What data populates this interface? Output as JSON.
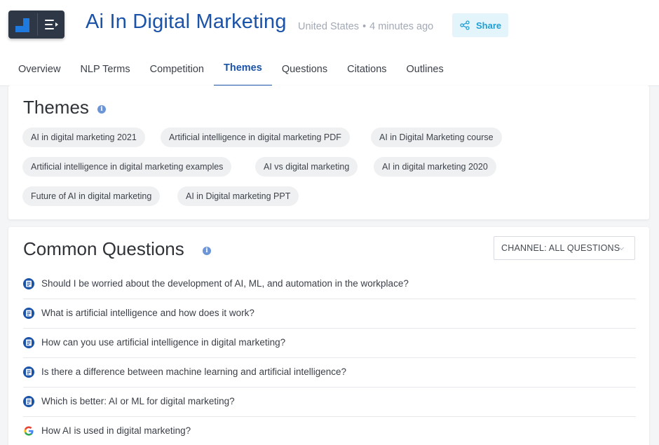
{
  "header": {
    "title": "Ai In Digital Marketing",
    "country": "United States",
    "updated": "4 minutes ago",
    "share_label": "Share"
  },
  "tabs": [
    {
      "label": "Overview",
      "active": false
    },
    {
      "label": "NLP Terms",
      "active": false
    },
    {
      "label": "Competition",
      "active": false
    },
    {
      "label": "Themes",
      "active": true
    },
    {
      "label": "Questions",
      "active": false
    },
    {
      "label": "Citations",
      "active": false
    },
    {
      "label": "Outlines",
      "active": false
    }
  ],
  "themes": {
    "title": "Themes",
    "chips": [
      "AI in digital marketing 2021",
      "Artificial intelligence in digital marketing PDF",
      "AI in Digital Marketing course",
      "Artificial intelligence in digital marketing examples",
      "AI vs digital marketing",
      "AI in digital marketing 2020",
      "Future of AI in digital marketing",
      "AI in Digital marketing PPT"
    ]
  },
  "questions": {
    "title": "Common Questions",
    "channel_label": "CHANNEL: ALL QUESTIONS",
    "items": [
      {
        "text": "Should I be worried about the development of AI, ML, and automation in the workplace?",
        "source": "quora-icon"
      },
      {
        "text": "What is artificial intelligence and how does it work?",
        "source": "quora-icon"
      },
      {
        "text": "How can you use artificial intelligence in digital marketing?",
        "source": "quora-icon"
      },
      {
        "text": "Is there a difference between machine learning and artificial intelligence?",
        "source": "quora-icon"
      },
      {
        "text": "Which is better: AI or ML for digital marketing?",
        "source": "quora-icon"
      },
      {
        "text": "How AI is used in digital marketing?",
        "source": "google-icon"
      }
    ]
  },
  "colors": {
    "brand_blue": "#1b53a8",
    "share_bg": "#e3f4fb",
    "share_text": "#1ea0d6",
    "chip_bg": "#eff0f2"
  }
}
